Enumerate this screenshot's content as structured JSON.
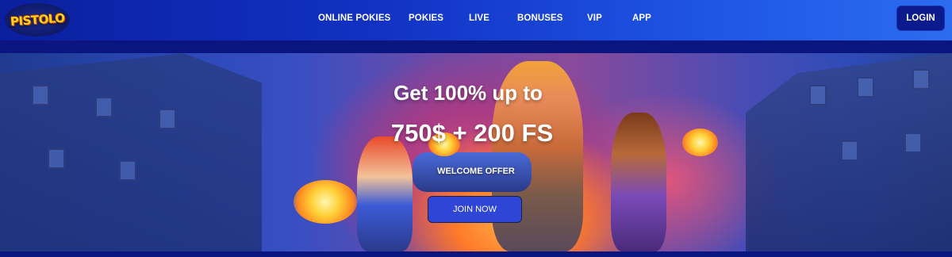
{
  "logo": {
    "text": "PISTOLO"
  },
  "nav": {
    "items": [
      {
        "label": "ONLINE POKIES"
      },
      {
        "label": "POKIES"
      },
      {
        "label": "LIVE"
      },
      {
        "label": "BONUSES"
      },
      {
        "label": "VIP"
      },
      {
        "label": "APP"
      }
    ],
    "login_label": "LOGIN"
  },
  "hero": {
    "title": "Get 100% up to",
    "amount": "750$ + 200 FS",
    "offer": "WELCOME OFFER",
    "cta_label": "JOIN NOW"
  },
  "colors": {
    "header_start": "#0a1f9e",
    "header_end": "#2b6cf0",
    "login_bg": "#0b1a8c",
    "cta_bg": "#2f45d6",
    "logo_yellow": "#ffd21f"
  }
}
